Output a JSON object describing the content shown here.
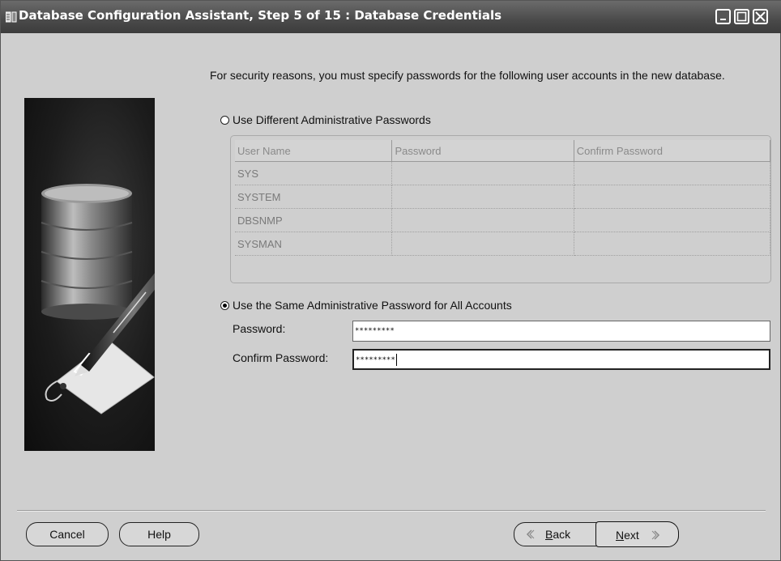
{
  "window": {
    "title": "Database Configuration Assistant, Step 5 of 15 : Database Credentials"
  },
  "intro_text": "For security reasons, you must specify passwords for the following user accounts in the new database.",
  "option_different": {
    "label": "Use Different Administrative Passwords",
    "selected": false
  },
  "accounts_table": {
    "columns": [
      "User Name",
      "Password",
      "Confirm Password"
    ],
    "rows": [
      {
        "user": "SYS",
        "password": "",
        "confirm": ""
      },
      {
        "user": "SYSTEM",
        "password": "",
        "confirm": ""
      },
      {
        "user": "DBSNMP",
        "password": "",
        "confirm": ""
      },
      {
        "user": "SYSMAN",
        "password": "",
        "confirm": ""
      }
    ]
  },
  "option_same": {
    "label": "Use the Same Administrative Password for All Accounts",
    "selected": true
  },
  "password_field": {
    "label": "Password:",
    "value": "*********"
  },
  "confirm_field": {
    "label": "Confirm Password:",
    "value": "*********"
  },
  "buttons": {
    "cancel": "Cancel",
    "help": "Help",
    "back_prefix": "",
    "back_accel": "B",
    "back_rest": "ack",
    "next_accel": "N",
    "next_rest": "ext"
  },
  "icons": {
    "app": "dbca-app-icon",
    "minimize": "minimize-icon",
    "maximize": "maximize-icon",
    "close": "close-icon",
    "back": "chevron-left-icon",
    "next": "chevron-right-icon"
  }
}
